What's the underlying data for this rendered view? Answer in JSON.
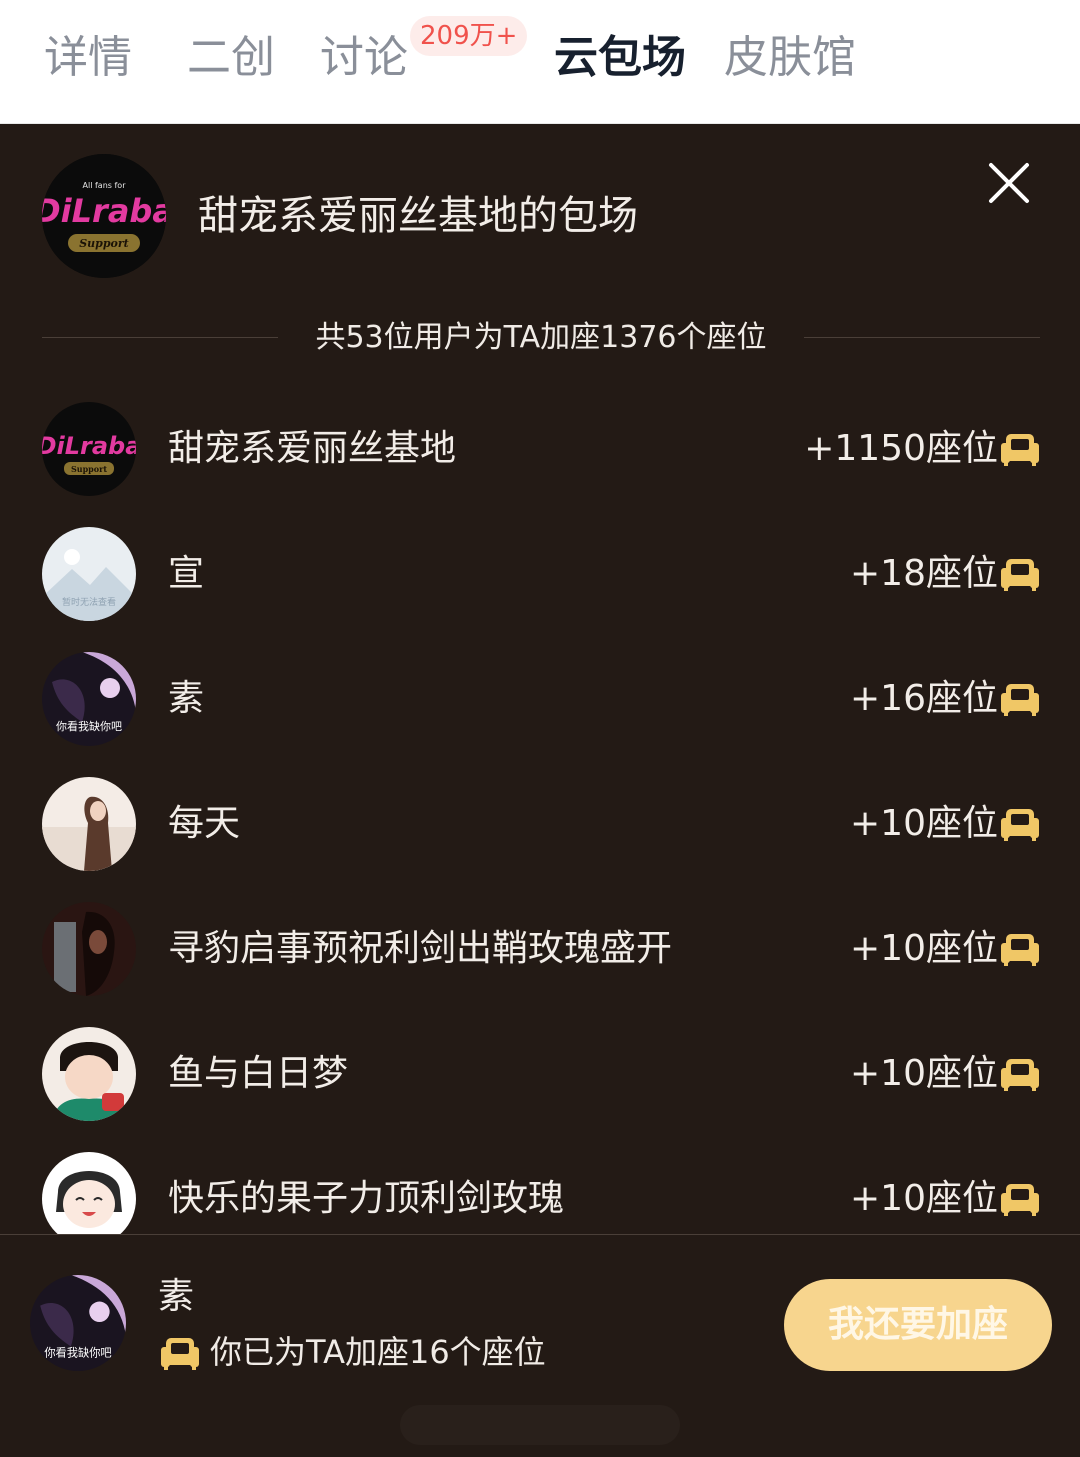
{
  "tabs": [
    {
      "label": "详情"
    },
    {
      "label": "二创"
    },
    {
      "label": "讨论",
      "badge": "209万+"
    },
    {
      "label": "云包场"
    },
    {
      "label": "皮肤馆"
    }
  ],
  "active_tab": "云包场",
  "panel": {
    "title": "甜宠系爱丽丝基地的包场",
    "summary": "共53位用户为TA加座1376个座位",
    "host_avatar": {
      "big_text": "DiLraba",
      "small_top": "All fans for",
      "pill": "Support"
    }
  },
  "rows": [
    {
      "name": "甜宠系爱丽丝基地",
      "seats": "+1150座位"
    },
    {
      "name": "宣",
      "seats": "+18座位",
      "avatar_caption": "暂时无法查看"
    },
    {
      "name": "素",
      "seats": "+16座位",
      "avatar_caption": "你看我缺你吧"
    },
    {
      "name": "每天",
      "seats": "+10座位"
    },
    {
      "name": "寻豹启事预祝利剑出鞘玫瑰盛开",
      "seats": "+10座位"
    },
    {
      "name": "鱼与白日梦",
      "seats": "+10座位"
    },
    {
      "name": "快乐的果子力顶利剑玫瑰",
      "seats": "+10座位"
    }
  ],
  "bottom": {
    "name": "素",
    "avatar_caption": "你看我缺你吧",
    "desc": "你已为TA加座16个座位",
    "button": "我还要加座"
  },
  "colors": {
    "panel_bg": "#231a15",
    "accent_gold": "#f7d58e",
    "seat_icon": "#f0c766",
    "badge_red": "#f0524c"
  },
  "icons": {
    "close": "close-icon",
    "seat": "sofa-seat-icon"
  }
}
